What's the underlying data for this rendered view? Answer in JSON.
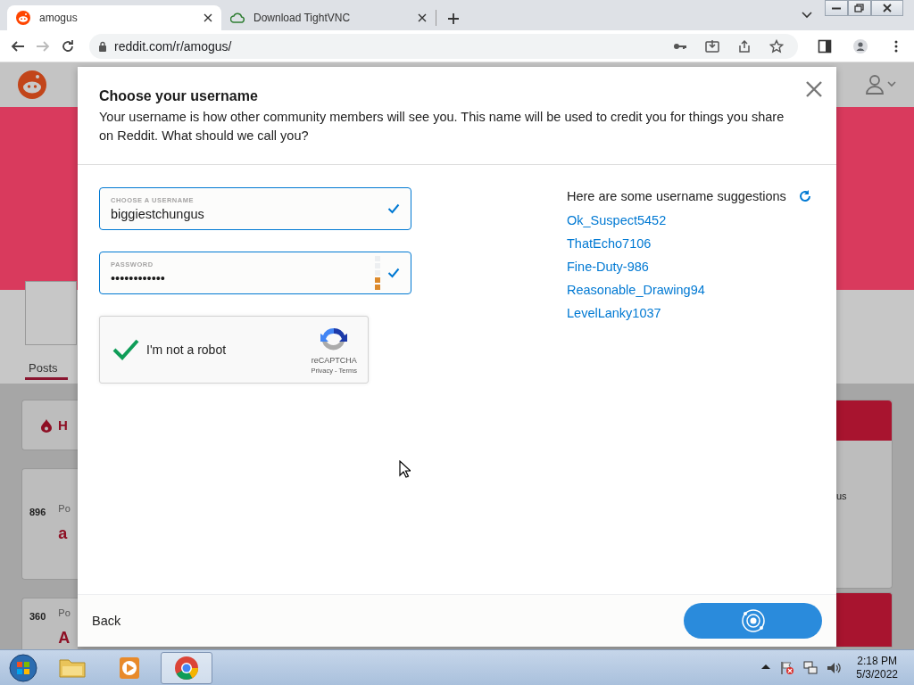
{
  "browser": {
    "tabs": [
      {
        "title": "amogus",
        "selected": true
      },
      {
        "title": "Download TightVNC",
        "selected": false
      }
    ],
    "url": "reddit.com/r/amogus/"
  },
  "background_page": {
    "tab_label": "Posts",
    "hot_button": "H",
    "sidebar_text": "us",
    "posts": [
      {
        "votes": "896",
        "meta": "Po",
        "title": "a"
      },
      {
        "votes": "360",
        "meta": "Po",
        "title": "A"
      }
    ]
  },
  "modal": {
    "title": "Choose your username",
    "description": "Your username is how other community members will see you. This name will be used to credit you for things you share on Reddit. What should we call you?",
    "username_field": {
      "label": "CHOOSE A USERNAME",
      "value": "biggiestchungus",
      "valid": true
    },
    "password_field": {
      "label": "PASSWORD",
      "value": "••••••••••••",
      "valid": true,
      "level": 0.4
    },
    "captcha": {
      "label": "I'm not a robot",
      "checked": true,
      "brand": "reCAPTCHA",
      "links": "Privacy - Terms"
    },
    "suggestions_heading": "Here are some username suggestions",
    "suggestions": [
      "Ok_Suspect5452",
      "ThatEcho7106",
      "Fine-Duty-986",
      "Reasonable_Drawing94",
      "LevelLanky1037"
    ],
    "back": "Back",
    "continue_loading": true
  },
  "taskbar": {
    "time": "2:18 PM",
    "date": "5/3/2022"
  }
}
